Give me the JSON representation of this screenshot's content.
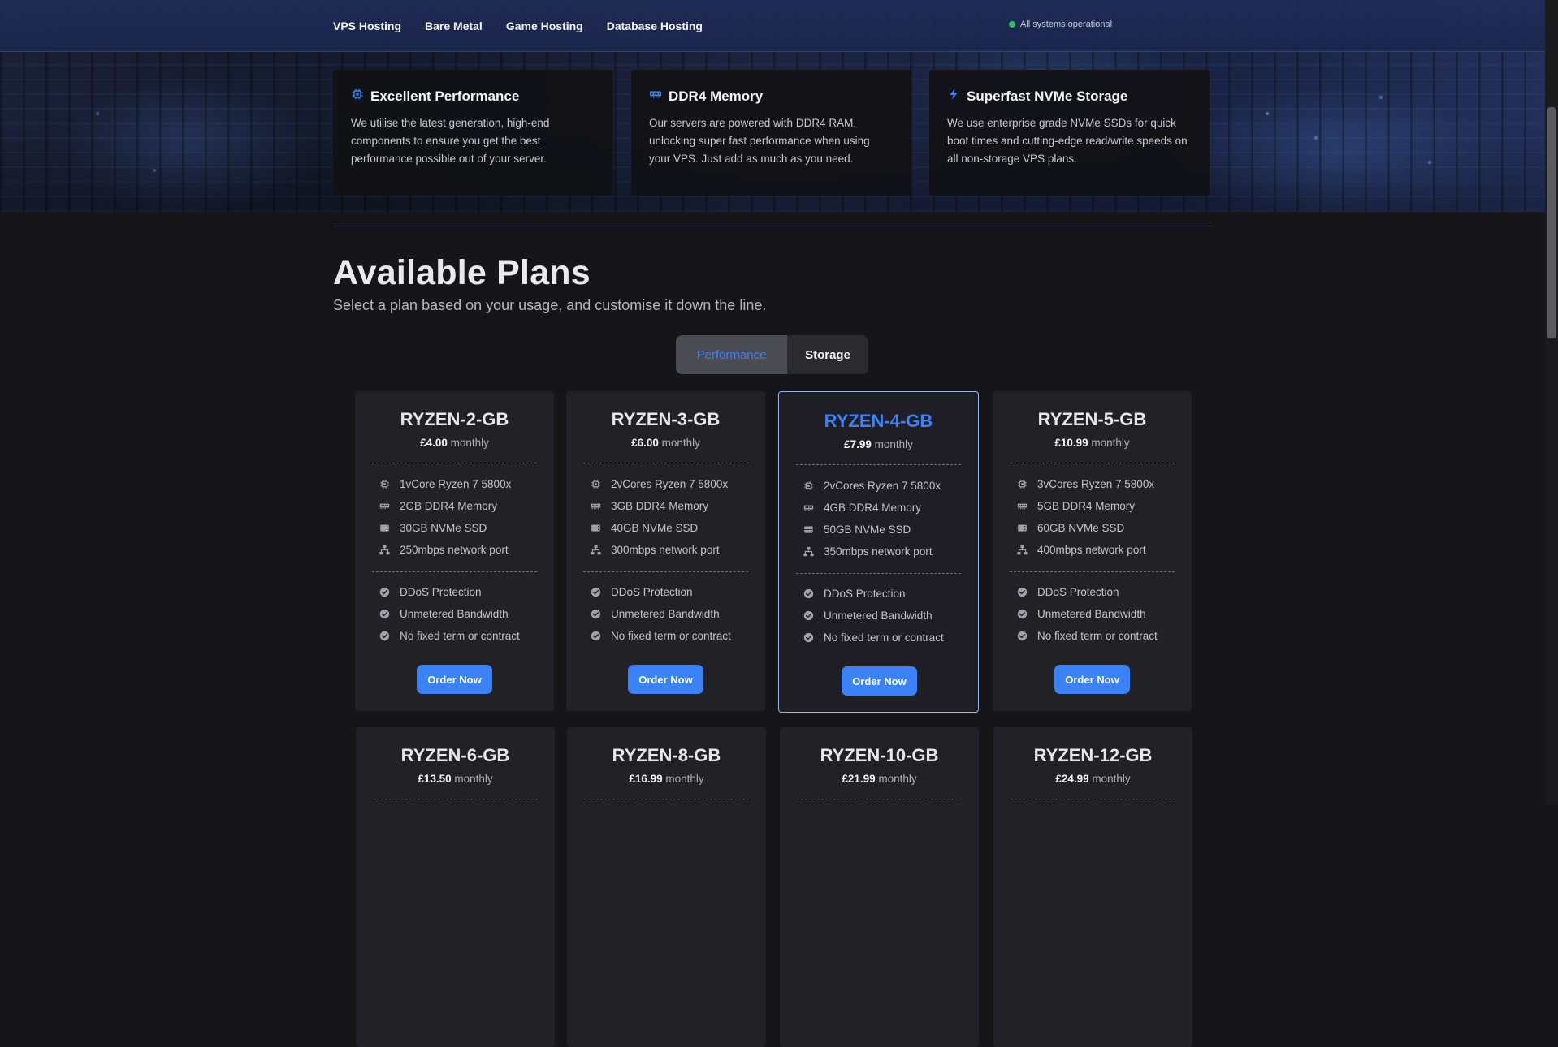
{
  "nav": {
    "items": [
      "VPS Hosting",
      "Bare Metal",
      "Game Hosting",
      "Database Hosting"
    ],
    "status_text": "All systems operational",
    "status_color": "#22c55e"
  },
  "features": [
    {
      "icon": "cpu-icon",
      "title": "Excellent Performance",
      "desc": "We utilise the latest generation, high-end components to ensure you get the best performance possible out of your server."
    },
    {
      "icon": "memory-icon",
      "title": "DDR4 Memory",
      "desc": "Our servers are powered with DDR4 RAM, unlocking super fast performance when using your VPS. Just add as much as you need."
    },
    {
      "icon": "bolt-icon",
      "title": "Superfast NVMe Storage",
      "desc": "We use enterprise grade NVMe SSDs for quick boot times and cutting-edge read/write speeds on all non-storage VPS plans."
    }
  ],
  "plans_section": {
    "title": "Available Plans",
    "subtitle": "Select a plan based on your usage, and customise it down the line."
  },
  "toggle": {
    "options": [
      "Performance",
      "Storage"
    ],
    "selected": "Performance"
  },
  "colors": {
    "accent": "#3b82f6",
    "featured_border": "#93b4f0"
  },
  "plans": [
    {
      "name": "RYZEN-2-GB",
      "price": "£4.00",
      "period": "monthly",
      "specs": [
        "1vCore Ryzen 7 5800x",
        "2GB DDR4 Memory",
        "30GB NVMe SSD",
        "250mbps network port"
      ],
      "perks": [
        "DDoS Protection",
        "Unmetered Bandwidth",
        "No fixed term or contract"
      ],
      "cta": "Order Now",
      "featured": false
    },
    {
      "name": "RYZEN-3-GB",
      "price": "£6.00",
      "period": "monthly",
      "specs": [
        "2vCores Ryzen 7 5800x",
        "3GB DDR4 Memory",
        "40GB NVMe SSD",
        "300mbps network port"
      ],
      "perks": [
        "DDoS Protection",
        "Unmetered Bandwidth",
        "No fixed term or contract"
      ],
      "cta": "Order Now",
      "featured": false
    },
    {
      "name": "RYZEN-4-GB",
      "price": "£7.99",
      "period": "monthly",
      "specs": [
        "2vCores Ryzen 7 5800x",
        "4GB DDR4 Memory",
        "50GB NVMe SSD",
        "350mbps network port"
      ],
      "perks": [
        "DDoS Protection",
        "Unmetered Bandwidth",
        "No fixed term or contract"
      ],
      "cta": "Order Now",
      "featured": true
    },
    {
      "name": "RYZEN-5-GB",
      "price": "£10.99",
      "period": "monthly",
      "specs": [
        "3vCores Ryzen 7 5800x",
        "5GB DDR4 Memory",
        "60GB NVMe SSD",
        "400mbps network port"
      ],
      "perks": [
        "DDoS Protection",
        "Unmetered Bandwidth",
        "No fixed term or contract"
      ],
      "cta": "Order Now",
      "featured": false
    },
    {
      "name": "RYZEN-6-GB",
      "price": "£13.50",
      "period": "monthly"
    },
    {
      "name": "RYZEN-8-GB",
      "price": "£16.99",
      "period": "monthly"
    },
    {
      "name": "RYZEN-10-GB",
      "price": "£21.99",
      "period": "monthly"
    },
    {
      "name": "RYZEN-12-GB",
      "price": "£24.99",
      "period": "monthly"
    }
  ],
  "spec_icons": [
    "cpu-icon",
    "memory-icon",
    "storage-icon",
    "network-icon"
  ],
  "perk_icon": "check-circle-icon"
}
